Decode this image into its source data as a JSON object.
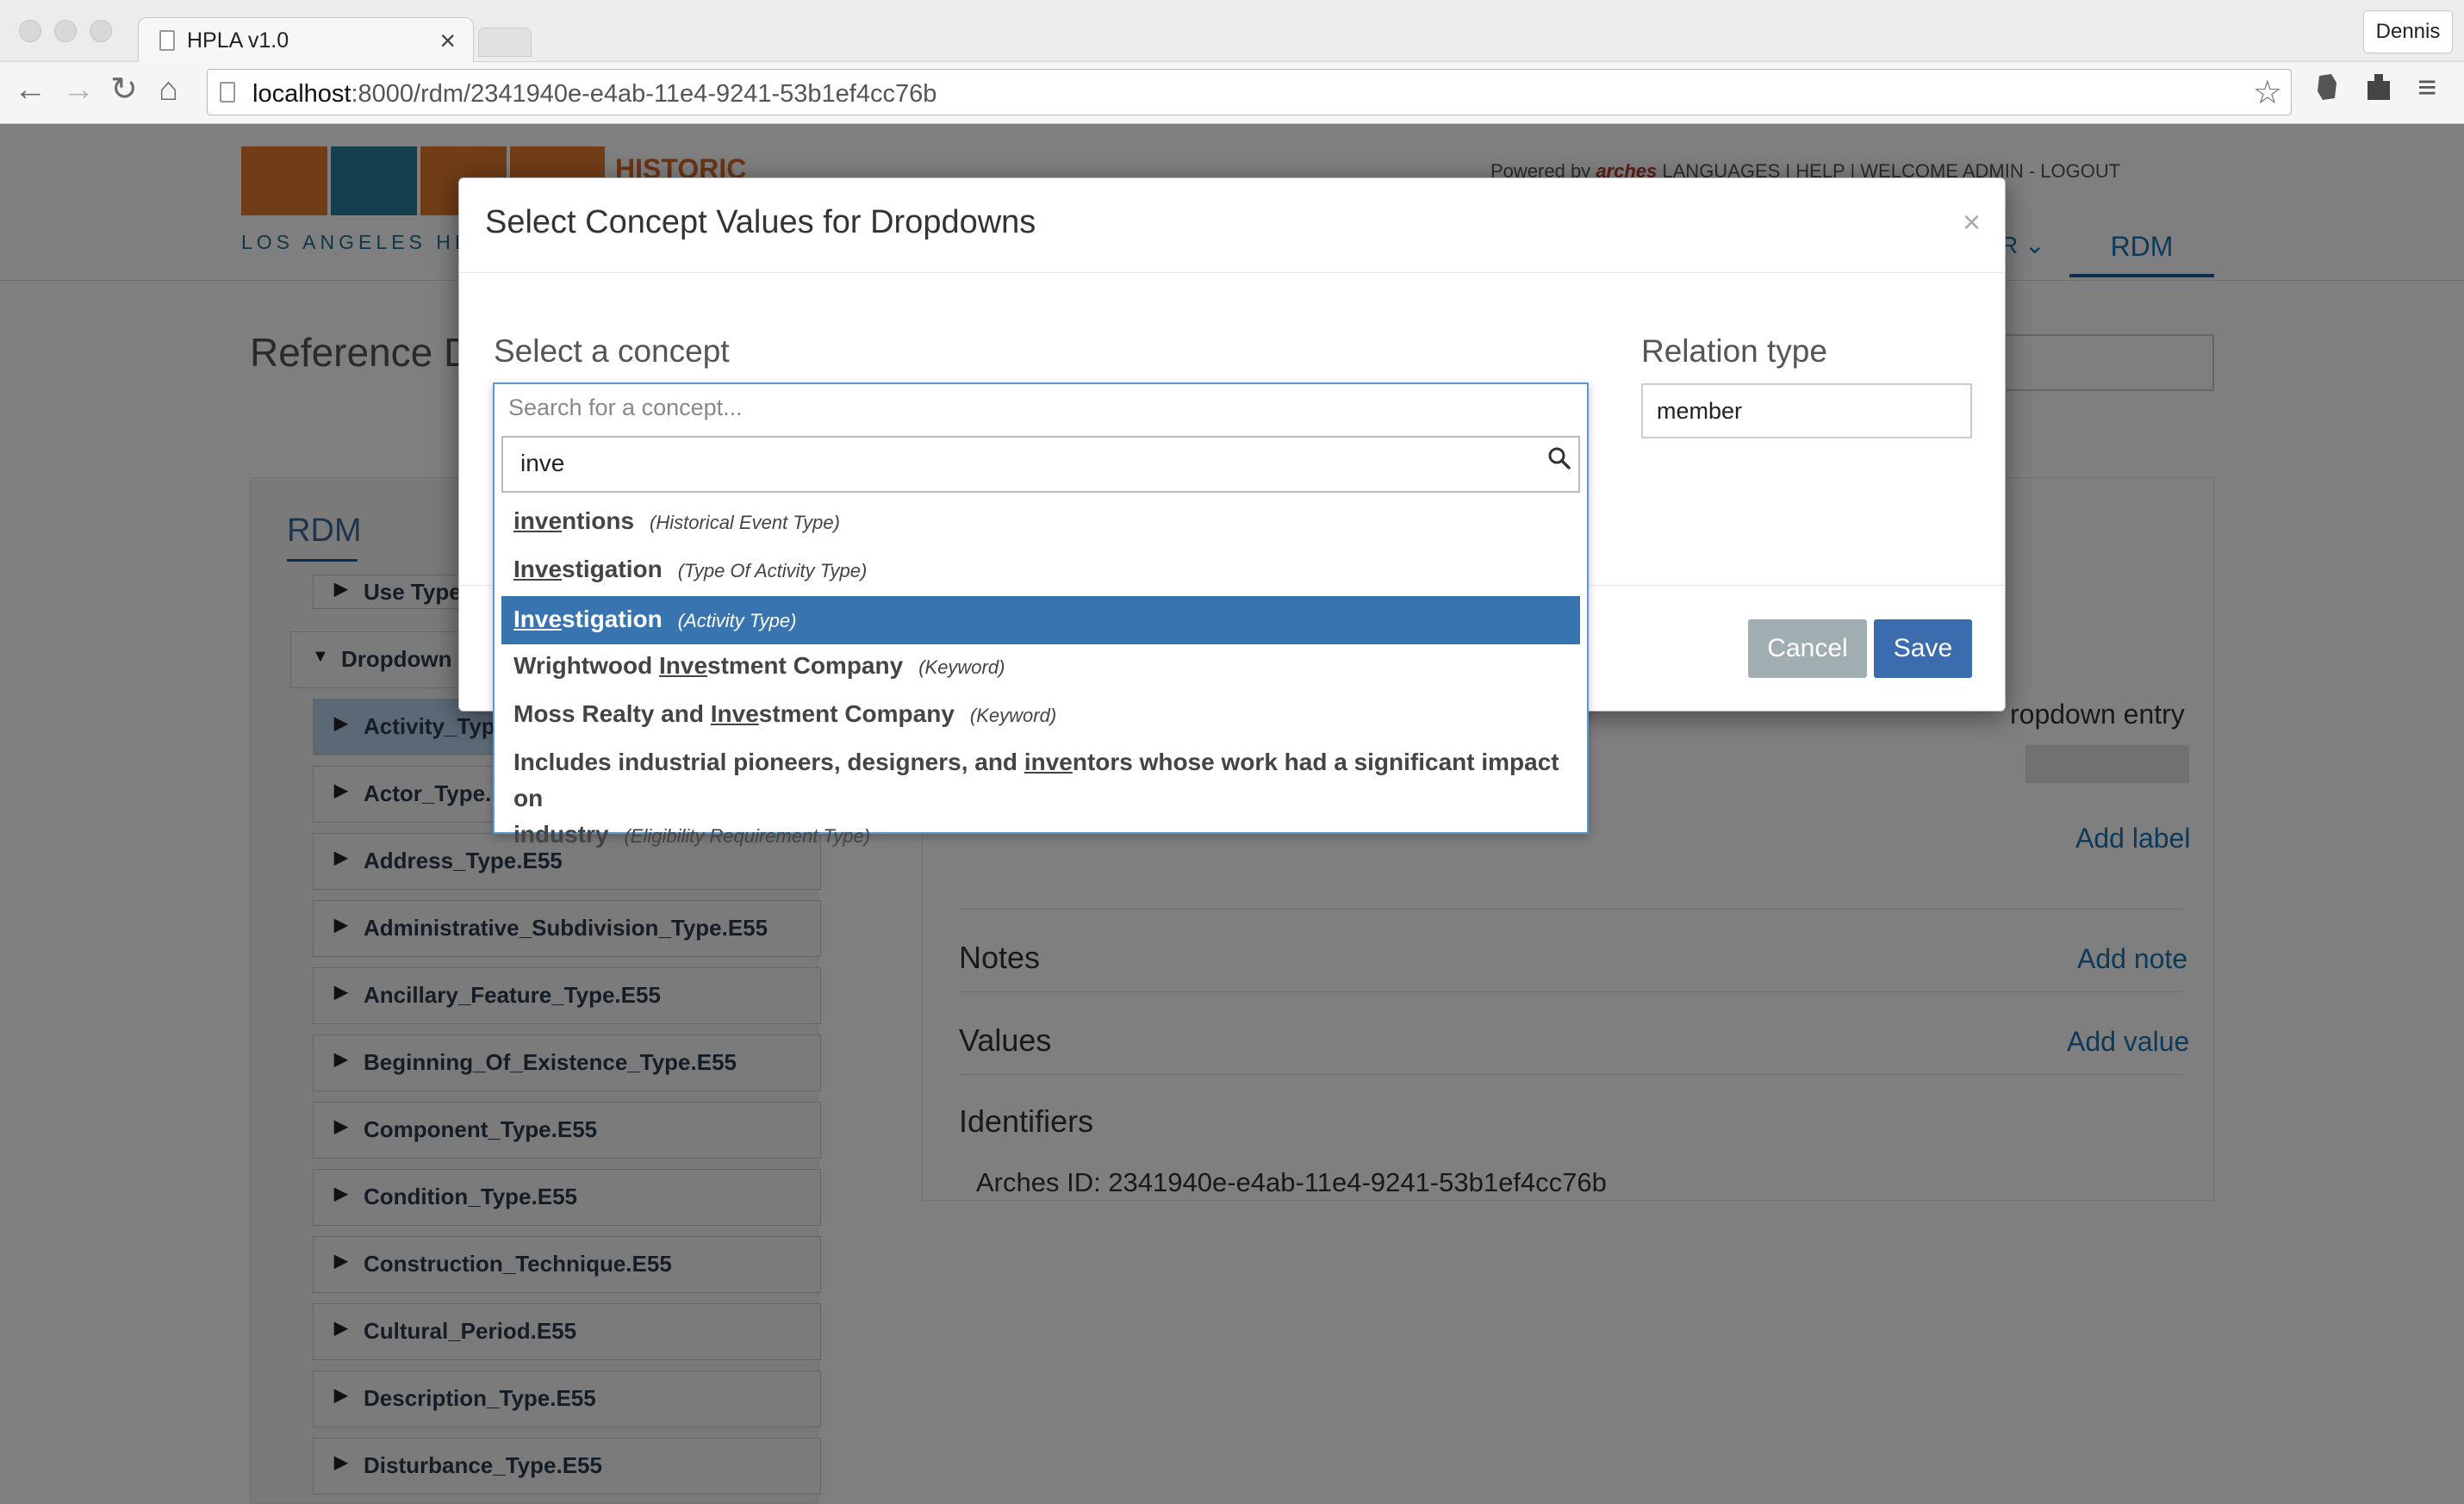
{
  "browser": {
    "tab_title": "HPLA v1.0",
    "tab_close": "×",
    "profile_name": "Dennis",
    "url_host": "localhost",
    "url_rest": ":8000/rdm/2341940e-e4ab-11e4-9241-53b1ef4cc76b",
    "nav": {
      "back": "←",
      "forward": "→",
      "reload": "↻",
      "home": "⌂",
      "star": "☆",
      "menu": "≡"
    }
  },
  "site": {
    "logo_text": "LOS ANGELES HIS",
    "logo_historic": "HISTORIC",
    "top_links": {
      "powered_by": "Powered by",
      "brand": "arches",
      "links": "LANGUAGES  |  HELP  |  WELCOME ADMIN - LOGOUT"
    },
    "nav_partial": "R ⌄",
    "nav_active": "RDM"
  },
  "page": {
    "title": "Reference Da",
    "rdm_heading": "RDM",
    "tree_items": [
      {
        "label": "Use Type",
        "arrow": "▶"
      },
      {
        "label": "Dropdown",
        "arrow": "▼"
      },
      {
        "label": "Activity_Typ",
        "arrow": "▶"
      },
      {
        "label": "Actor_Type.",
        "arrow": "▶"
      },
      {
        "label": "Address_Type.E55",
        "arrow": "▶"
      },
      {
        "label": "Administrative_Subdivision_Type.E55",
        "arrow": "▶"
      },
      {
        "label": "Ancillary_Feature_Type.E55",
        "arrow": "▶"
      },
      {
        "label": "Beginning_Of_Existence_Type.E55",
        "arrow": "▶"
      },
      {
        "label": "Component_Type.E55",
        "arrow": "▶"
      },
      {
        "label": "Condition_Type.E55",
        "arrow": "▶"
      },
      {
        "label": "Construction_Technique.E55",
        "arrow": "▶"
      },
      {
        "label": "Cultural_Period.E55",
        "arrow": "▶"
      },
      {
        "label": "Description_Type.E55",
        "arrow": "▶"
      },
      {
        "label": "Disturbance_Type.E55",
        "arrow": "▶"
      }
    ],
    "detail": {
      "dropdown_entry": "ropdown entry",
      "add_label": "Add label",
      "notes": "Notes",
      "add_note": "Add note",
      "values": "Values",
      "add_value": "Add value",
      "identifiers": "Identifiers",
      "arches_id": "Arches ID: 2341940e-e4ab-11e4-9241-53b1ef4cc76b"
    }
  },
  "modal": {
    "title": "Select Concept Values for Dropdowns",
    "close": "×",
    "concept_label": "Select a concept",
    "relation_label": "Relation type",
    "relation_value": "member",
    "cancel": "Cancel",
    "save": "Save",
    "concept_placeholder": "Search for a concept...",
    "search_value": "inve",
    "results": [
      {
        "pre": "",
        "match": "inve",
        "post": "ntions",
        "type": "(Historical Event Type)"
      },
      {
        "pre": "",
        "match": "Inve",
        "post": "stigation",
        "type": "(Type Of Activity Type)"
      },
      {
        "pre": "",
        "match": "Inve",
        "post": "stigation",
        "type": "(Activity Type)"
      },
      {
        "pre": "Wrightwood ",
        "match": "Inve",
        "post": "stment Company",
        "type": "(Keyword)"
      },
      {
        "pre": "Moss Realty and ",
        "match": "Inve",
        "post": "stment Company",
        "type": "(Keyword)"
      },
      {
        "pre": "Includes industrial pioneers, designers, and ",
        "match": "inve",
        "post": "ntors whose work had a significant impact on",
        "line2": "industry",
        "type": "(Eligibility Requirement Type)"
      }
    ]
  },
  "colors": {
    "accent": "#3b6cae",
    "highlight": "#3875b0",
    "cancel": "#a1aeb1",
    "link": "#1a74b7"
  }
}
